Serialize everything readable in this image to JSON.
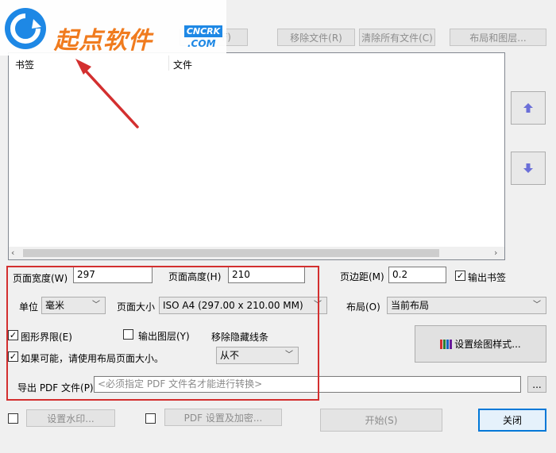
{
  "watermark": {
    "brand": "起点软件",
    "site": "CNCRK",
    "domain": ".COM"
  },
  "toolbar": {
    "add_file_partial": "F)",
    "remove_file": "移除文件(R)",
    "clear_all": "清除所有文件(C)",
    "layout_layers": "布局和图层..."
  },
  "list": {
    "columns": [
      "书签",
      "文件"
    ]
  },
  "page": {
    "width_label": "页面宽度(W)",
    "width_value": "297",
    "height_label": "页面高度(H)",
    "height_value": "210",
    "margin_label": "页边距(M)",
    "margin_value": "0.2",
    "output_bookmarks_label": "输出书签",
    "unit_label": "单位",
    "unit_value": "毫米",
    "size_label": "页面大小",
    "size_value": "ISO A4 (297.00 x 210.00 MM)",
    "layout_label": "布局(O)",
    "layout_value": "当前布局"
  },
  "options": {
    "limits_label": "图形界限(E)",
    "output_layers_label": "输出图层(Y)",
    "hidden_lines_label": "移除隐藏线条",
    "hidden_lines_value": "从不",
    "use_layout_size_label": "如果可能，请使用布局页面大小。",
    "plot_style_button": "设置绘图样式..."
  },
  "export": {
    "label": "导出 PDF 文件(P)",
    "placeholder": "<必须指定 PDF 文件名才能进行转换>",
    "browse": "..."
  },
  "bottom": {
    "watermark_button": "设置水印...",
    "pdf_security_button": "PDF 设置及加密...",
    "start_button": "开始(S)",
    "close_button": "关闭"
  },
  "colors": {
    "accent": "#0078d7",
    "highlight_box": "#d32f2f",
    "arrow_btn_icon": "#6b6fd8"
  }
}
